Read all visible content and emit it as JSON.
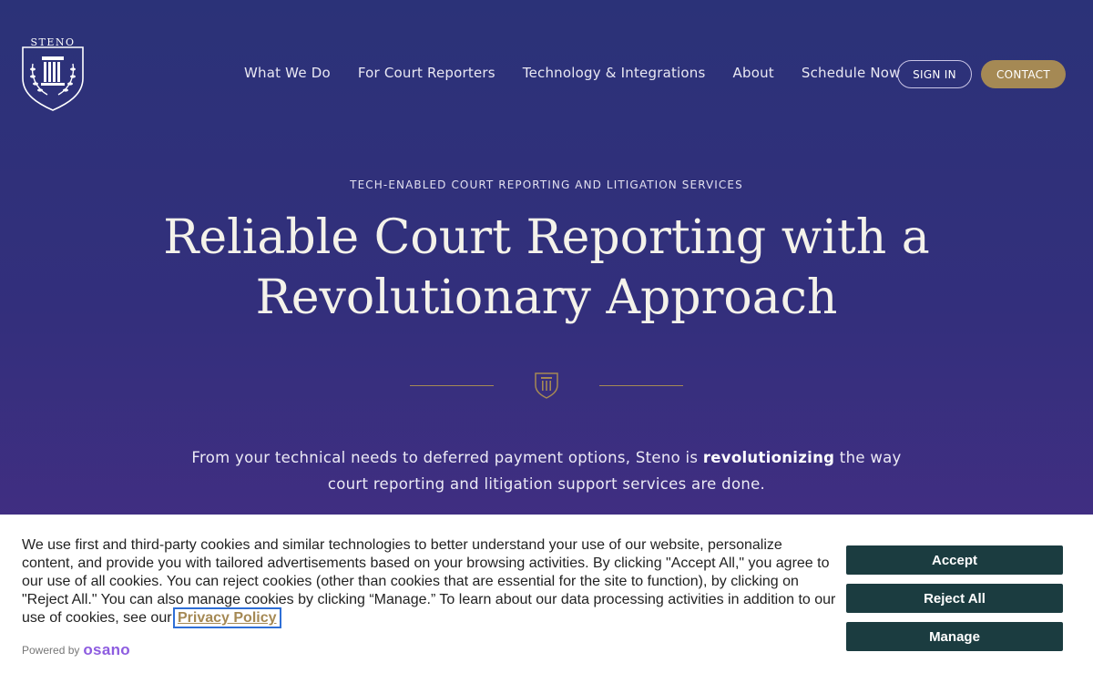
{
  "brand": {
    "logo_text": "STENO"
  },
  "nav": {
    "items": [
      {
        "label": "What We Do"
      },
      {
        "label": "For Court Reporters"
      },
      {
        "label": "Technology & Integrations"
      },
      {
        "label": "About"
      },
      {
        "label": "Schedule Now"
      }
    ],
    "signin_label": "SIGN IN",
    "contact_label": "CONTACT"
  },
  "hero": {
    "eyebrow": "TECH-ENABLED COURT REPORTING AND LITIGATION SERVICES",
    "headline_line1": "Reliable Court Reporting with a",
    "headline_line2": "Revolutionary Approach",
    "lede_before": "From your technical needs to deferred payment options, Steno is ",
    "lede_bold": "revolutionizing",
    "lede_after": " the way court reporting and litigation support services are done."
  },
  "cookie_banner": {
    "text": "We use first and third-party cookies and similar technologies to better understand your use of our website, personalize content, and provide you with tailored advertisements based on your browsing activities. By clicking \"Accept All,\" you agree to our use of all cookies. You can reject cookies (other than cookies that are essential for the site to function), by clicking on \"Reject All.\" You can also manage cookies by clicking “Manage.” To learn about our data processing activities in addition to our use of cookies, see our ",
    "privacy_link": "Privacy Policy",
    "period": ".",
    "powered_by": "Powered by",
    "osano_brand": "osano",
    "accept_label": "Accept",
    "reject_label": "Reject All",
    "manage_label": "Manage"
  },
  "colors": {
    "accent_gold": "#a58954",
    "bg_top": "#2b3278",
    "bg_bottom": "#4a2e86",
    "cookie_button": "#1b3c40",
    "osano_purple": "#8d5ce0"
  }
}
